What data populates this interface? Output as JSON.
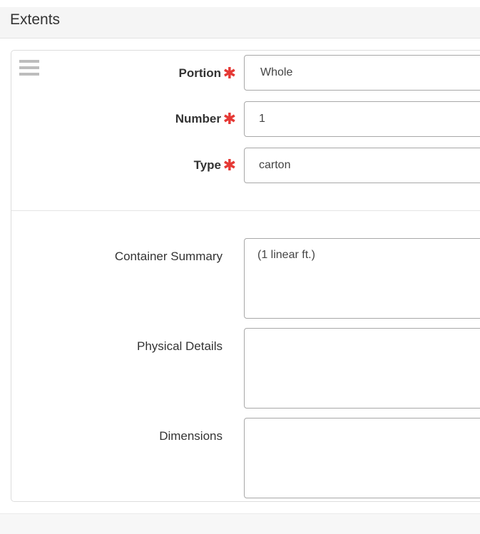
{
  "section": {
    "title": "Extents"
  },
  "fields": {
    "portion": {
      "label": "Portion",
      "value": "Whole",
      "required_mark": "✱"
    },
    "number": {
      "label": "Number",
      "value": "1",
      "required_mark": "✱"
    },
    "type": {
      "label": "Type",
      "value": "carton",
      "required_mark": "✱"
    },
    "container_summary": {
      "label": "Container Summary",
      "value": "(1 linear ft.)"
    },
    "physical_details": {
      "label": "Physical Details",
      "value": ""
    },
    "dimensions": {
      "label": "Dimensions",
      "value": ""
    }
  },
  "icons": {
    "drag_handle": "hamburger-drag-icon",
    "required": "asterisk-icon"
  },
  "colors": {
    "required": "#e53935",
    "header_bg": "#f5f5f5",
    "border": "#a8a8a8"
  }
}
